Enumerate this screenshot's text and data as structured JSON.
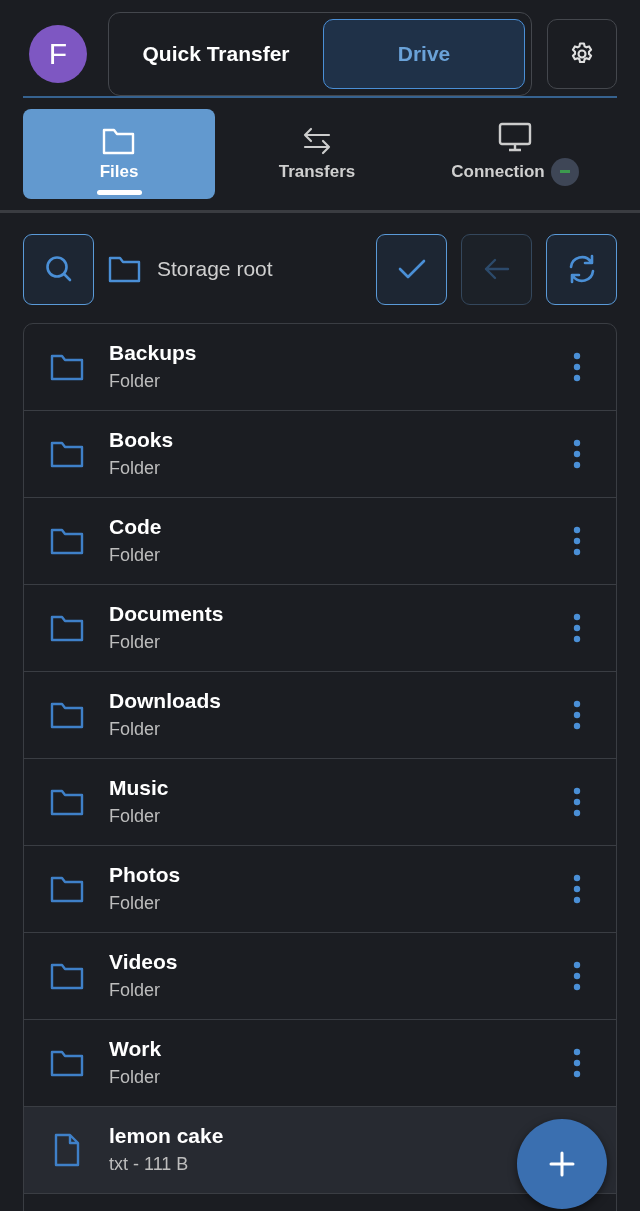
{
  "avatar": {
    "initial": "F"
  },
  "mode_switch": [
    {
      "label": "Quick Transfer",
      "selected": false
    },
    {
      "label": "Drive",
      "selected": true
    }
  ],
  "tabs": [
    {
      "label": "Files",
      "selected": true
    },
    {
      "label": "Transfers",
      "selected": false
    },
    {
      "label": "Connection",
      "selected": false,
      "connected": false
    }
  ],
  "toolbar": {
    "path": "Storage root",
    "back_disabled": true
  },
  "items": [
    {
      "kind": "folder",
      "name": "Backups",
      "detail": "Folder",
      "selected": false
    },
    {
      "kind": "folder",
      "name": "Books",
      "detail": "Folder",
      "selected": false
    },
    {
      "kind": "folder",
      "name": "Code",
      "detail": "Folder",
      "selected": false
    },
    {
      "kind": "folder",
      "name": "Documents",
      "detail": "Folder",
      "selected": false
    },
    {
      "kind": "folder",
      "name": "Downloads",
      "detail": "Folder",
      "selected": false
    },
    {
      "kind": "folder",
      "name": "Music",
      "detail": "Folder",
      "selected": false
    },
    {
      "kind": "folder",
      "name": "Photos",
      "detail": "Folder",
      "selected": false
    },
    {
      "kind": "folder",
      "name": "Videos",
      "detail": "Folder",
      "selected": false
    },
    {
      "kind": "folder",
      "name": "Work",
      "detail": "Folder",
      "selected": false
    },
    {
      "kind": "file",
      "name": "lemon cake",
      "detail": "txt - 111 B",
      "selected": true
    }
  ]
}
